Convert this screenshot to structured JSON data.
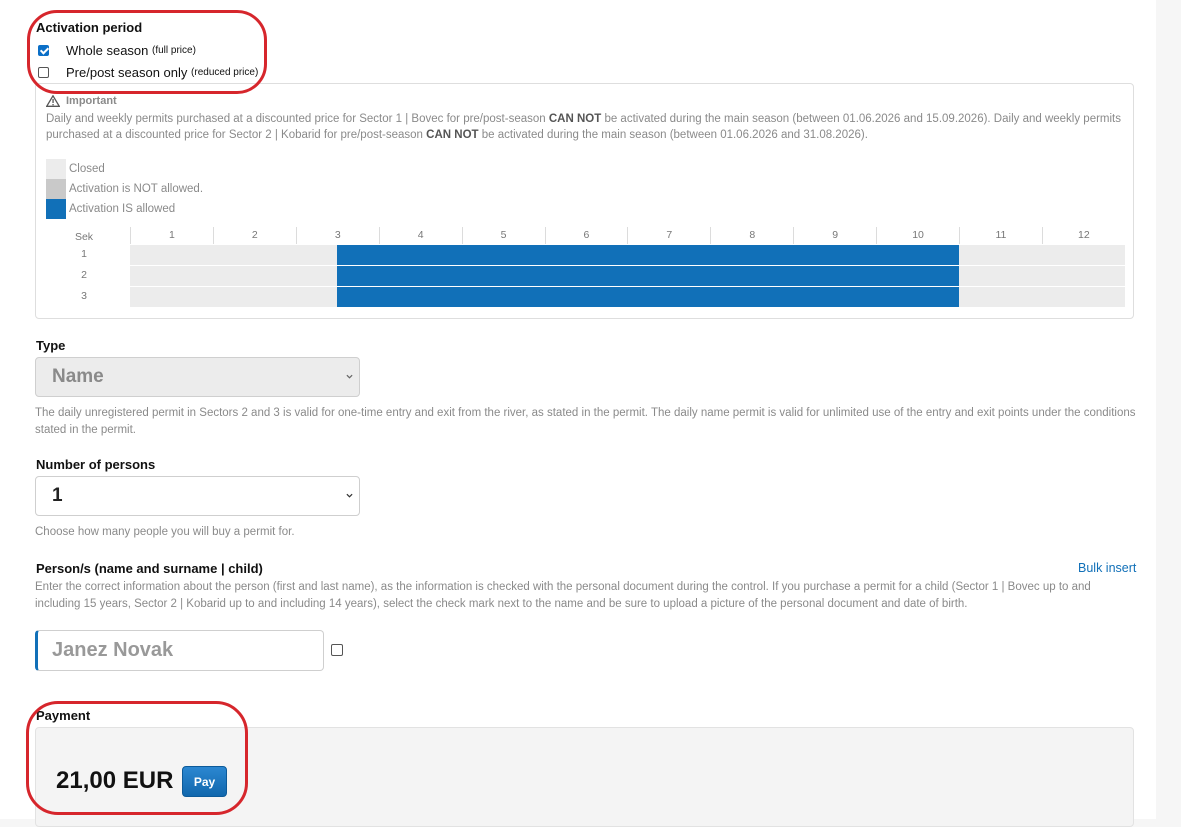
{
  "activation": {
    "title": "Activation period",
    "options": [
      {
        "label": "Whole season",
        "note": "(full price)",
        "checked": true
      },
      {
        "label": "Pre/post season only",
        "note": "(reduced price)",
        "checked": false
      }
    ]
  },
  "important": {
    "heading": "Important",
    "text_a": "Daily and weekly permits purchased at a discounted price for Sector 1 | Bovec for pre/post-season ",
    "bold_a": "CAN NOT",
    "text_b": " be activated during the main season (between 01.06.2026 and 15.09.2026). Daily and weekly permits purchased at a discounted price for Sector 2 | Kobarid for pre/post-season ",
    "bold_b": "CAN NOT",
    "text_c": " be activated during the main season (between 01.06.2026 and 31.08.2026).",
    "legend": [
      {
        "label": "Closed",
        "color": "#ececec"
      },
      {
        "label": "Activation is NOT allowed.",
        "color": "#c9c9c9"
      },
      {
        "label": "Activation IS allowed",
        "color": "#1170b8"
      }
    ]
  },
  "calendar": {
    "row_header": "Sek",
    "months": [
      "1",
      "2",
      "3",
      "4",
      "5",
      "6",
      "7",
      "8",
      "9",
      "10",
      "11",
      "12"
    ],
    "sectors": [
      "1",
      "2",
      "3"
    ],
    "allowed_from_month": 3.5,
    "allowed_to_month": 10
  },
  "type": {
    "label": "Type",
    "value": "Name",
    "help": "The daily unregistered permit in Sectors 2 and 3 is valid for one-time entry and exit from the river, as stated in the permit. The daily name permit is valid for unlimited use of the entry and exit points under the conditions stated in the permit."
  },
  "persons_count": {
    "label": "Number of persons",
    "value": "1",
    "help": "Choose how many people you will buy a permit for."
  },
  "persons": {
    "label": "Person/s (name and surname | child)",
    "bulk_insert": "Bulk insert",
    "help": "Enter the correct information about the person (first and last name), as the information is checked with the personal document during the control. If you purchase a permit for a child (Sector 1 | Bovec up to and including 15 years, Sector 2 | Kobarid up to and including 14 years), select the check mark next to the name and be sure to upload a picture of the personal document and date of birth.",
    "name_placeholder": "Janez Novak"
  },
  "payment": {
    "label": "Payment",
    "amount": "21,00 EUR",
    "pay_button": "Pay"
  },
  "colors": {
    "accent": "#1170b8",
    "highlight_outline": "#d6262c"
  }
}
